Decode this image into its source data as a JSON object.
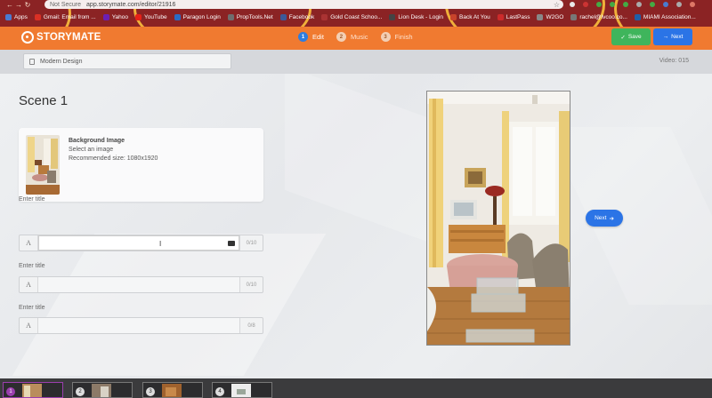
{
  "browser": {
    "security": "Not Secure",
    "url": "app.storymate.com/editor/21916",
    "bookmarks": [
      {
        "label": "Apps",
        "color": "#4a7bd0"
      },
      {
        "label": "Gmail: Email from ...",
        "color": "#d93025"
      },
      {
        "label": "Yahoo",
        "color": "#6b1fb3"
      },
      {
        "label": "YouTube",
        "color": "#e62117"
      },
      {
        "label": "Paragon Login",
        "color": "#2a6bc4"
      },
      {
        "label": "PropTools.Net",
        "color": "#6e6e6e"
      },
      {
        "label": "Facebook",
        "color": "#3b5998"
      },
      {
        "label": "Gold Coast Schoo...",
        "color": "#a33"
      },
      {
        "label": "Lion Desk - Login",
        "color": "#444"
      },
      {
        "label": "Back At You",
        "color": "#c8432b"
      },
      {
        "label": "LastPass",
        "color": "#cc2b2b"
      },
      {
        "label": "W2GO",
        "color": "#888"
      },
      {
        "label": "rachel@lvcoo.co...",
        "color": "#777"
      },
      {
        "label": "MIAMI Association...",
        "color": "#1f5fa8"
      }
    ]
  },
  "header": {
    "logo": "STORYMATE",
    "steps": [
      {
        "num": "1",
        "label": "Edit"
      },
      {
        "num": "2",
        "label": "Music"
      },
      {
        "num": "3",
        "label": "Finish"
      }
    ],
    "save_label": "Save",
    "next_label": "Next",
    "save_color": "#3fb55c",
    "next_color": "#2b74e6",
    "brand_color": "#f07a30"
  },
  "subbar": {
    "project_name": "Modern Design",
    "video_label": "Video: 015"
  },
  "scene": {
    "title": "Scene 1",
    "background": {
      "heading": "Background Image",
      "action": "Select an image",
      "recommended": "Recommended size: 1080x1920"
    },
    "fields": [
      {
        "label": "Enter title",
        "prefix": "A",
        "value": "",
        "counter": "0/10"
      },
      {
        "label": "Enter title",
        "prefix": "A",
        "value": "",
        "counter": "0/10"
      },
      {
        "label": "Enter title",
        "prefix": "A",
        "value": "",
        "counter": "0/8"
      }
    ]
  },
  "preview": {
    "next_label": "Next"
  },
  "timeline": {
    "scenes": [
      "1",
      "2",
      "3",
      "4"
    ]
  }
}
